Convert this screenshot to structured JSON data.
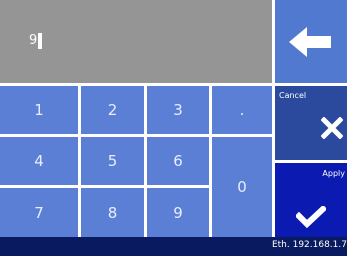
{
  "display": {
    "value": "9"
  },
  "keypad": {
    "keys": [
      "1",
      "2",
      "3",
      ".",
      "4",
      "5",
      "6",
      "0",
      "7",
      "8",
      "9"
    ]
  },
  "actions": {
    "cancel_label": "Cancel",
    "apply_label": "Apply",
    "backspace_icon": "arrow-left-icon",
    "cancel_icon": "close-icon",
    "apply_icon": "check-icon"
  },
  "status": {
    "ip_text": "Eth. 192.168.1.7"
  },
  "colors": {
    "display_bg": "#959595",
    "key_bg": "#5b7fd4",
    "cancel_bg": "#2b4a9e",
    "apply_bg": "#0b1ab0",
    "status_bg": "#0a1a60"
  }
}
